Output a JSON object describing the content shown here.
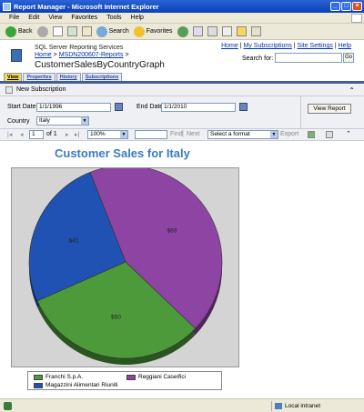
{
  "window": {
    "title": "Report Manager - Microsoft Internet Explorer"
  },
  "menu": [
    "File",
    "Edit",
    "View",
    "Favorites",
    "Tools",
    "Help"
  ],
  "toolbar": {
    "back": "Back",
    "search": "Search",
    "favorites": "Favorites"
  },
  "header": {
    "app_name": "SQL Server Reporting Services",
    "breadcrumb_home": "Home",
    "breadcrumb_sep": ">",
    "breadcrumb_folder": "MSDN200607-Reports",
    "breadcrumb_sep2": ">",
    "report_title": "CustomerSalesByCountryGraph",
    "links": [
      "Home",
      "My Subscriptions",
      "Site Settings",
      "Help"
    ],
    "link_sep": "|",
    "search_label": "Search for:",
    "go": "Go"
  },
  "tabs": [
    "View",
    "Properties",
    "History",
    "Subscriptions"
  ],
  "subscription": {
    "label": "New Subscription"
  },
  "params": {
    "start_label": "Start Date",
    "start_value": "1/1/1996",
    "end_label": "End Date",
    "end_value": "1/1/2010",
    "country_label": "Country",
    "country_value": "Italy",
    "view_report": "View Report"
  },
  "nav": {
    "page": "1",
    "of": "of 1",
    "zoom": "100%",
    "find": "Find",
    "sep": "|",
    "next": "Next",
    "format": "Select a format",
    "export": "Export"
  },
  "chart_data": {
    "type": "pie",
    "title": "Customer Sales for Italy",
    "slices": [
      {
        "name": "Reggiani Caseifici",
        "label": "$69",
        "value": 69,
        "color": "#8e44a3"
      },
      {
        "name": "Franchi S.p.A.",
        "label": "$50",
        "value": 50,
        "color": "#4c9a3a"
      },
      {
        "name": "Magazzini Alimentari Riuniti",
        "label": "$41",
        "value": 41,
        "color": "#1f52b3"
      }
    ],
    "legend": [
      "Franchi S.p.A.",
      "Reggiani Caseifici",
      "Magazzini Alimentari Riuniti"
    ]
  },
  "status": {
    "zone": "Local intranet"
  }
}
